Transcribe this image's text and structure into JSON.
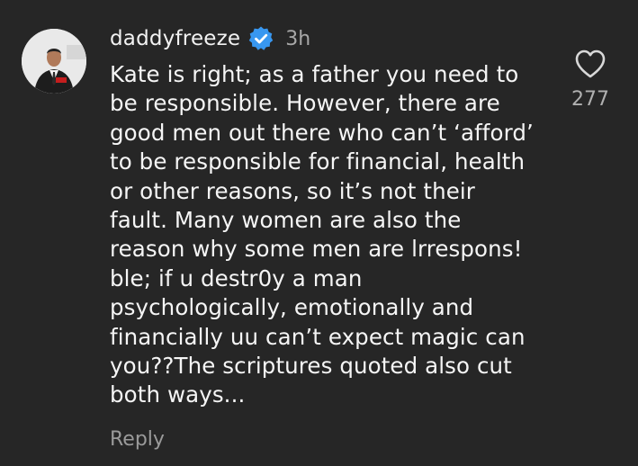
{
  "comment": {
    "username": "daddyfreeze",
    "time": "3h",
    "lines": [
      "Kate is right; as a father you need to",
      "be responsible. However, there are",
      "good men out there who can’t ‘afford’",
      "to be responsible for financial, health",
      "or other reasons, so it’s not their",
      "fault. Many women are also the",
      "reason why some men are lrrespons!",
      "ble; if u destr0y a man",
      "psychologically, emotionally and",
      "financially uu can’t expect magic can",
      "you??The scriptures quoted also cut",
      "both ways..."
    ],
    "reply_label": "Reply",
    "likes": "277",
    "verified_icon": "verified-badge-icon",
    "like_icon": "heart-outline-icon"
  },
  "colors": {
    "background": "#262626",
    "verified_blue": "#3897f0",
    "muted": "#a8a8a8"
  }
}
